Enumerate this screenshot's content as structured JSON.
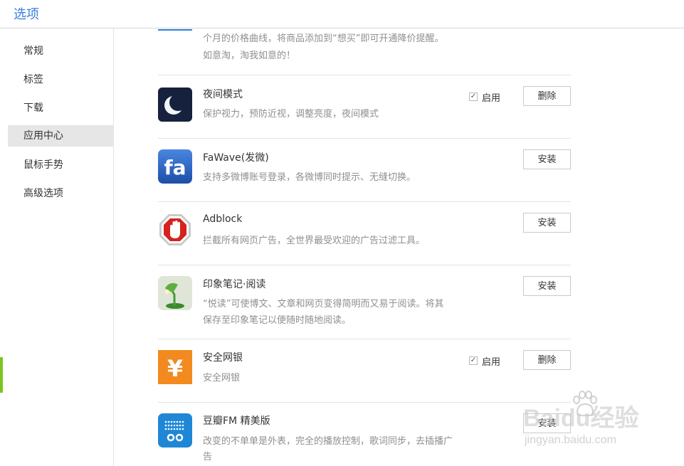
{
  "header": {
    "title": "选项"
  },
  "sidebar": {
    "items": [
      {
        "label": "常规"
      },
      {
        "label": "标签"
      },
      {
        "label": "下载"
      },
      {
        "label": "应用中心",
        "active": true
      },
      {
        "label": "鼠标手势"
      },
      {
        "label": "高级选项"
      }
    ]
  },
  "main": {
    "top_fragment": {
      "desc_line1": "个月的价格曲线，将商品添加到“想买”即可开通降价提醒。",
      "desc_line2": "如意淘，淘我如意的！"
    },
    "extensions": [
      {
        "name": "夜间模式",
        "desc_line1": "保护视力，预防近视，调整亮度，夜间模式",
        "enabled": true,
        "enable_label": "启用",
        "button": "删除",
        "icon": "moon-icon"
      },
      {
        "name": "FaWave(发微)",
        "desc_line1": "支持多微博账号登录，各微博同时提示、无缝切换。",
        "button": "安装",
        "icon": "fawave-icon"
      },
      {
        "name": "Adblock",
        "desc_line1": "拦截所有网页广告，全世界最受欢迎的广告过滤工具。",
        "button": "安装",
        "icon": "adblock-hand-icon"
      },
      {
        "name": "印象笔记·阅读",
        "desc_line1": "“悦读”可使博文、文章和网页变得简明而又易于阅读。将其",
        "desc_line2": "保存至印象笔记以便随时随地阅读。",
        "button": "安装",
        "icon": "desk-lamp-icon"
      },
      {
        "name": "安全网银",
        "desc_line1": "安全网银",
        "enabled": true,
        "enable_label": "启用",
        "button": "删除",
        "icon": "yen-icon"
      },
      {
        "name": "豆瓣FM 精美版",
        "desc_line1": "改变的不单单是外表，完全的播放控制，歌词同步，去插播广",
        "desc_line2": "告",
        "button": "安装",
        "icon": "radio-icon"
      }
    ]
  },
  "watermark": {
    "main": "Baidu经验",
    "sub": "jingyan.baidu.com"
  },
  "colors": {
    "title_blue": "#3a7fd6",
    "active_nav_bg": "#e6e6e6",
    "left_marker_green": "#7cc520",
    "desc_gray": "#8f8f8f",
    "divider": "#e3e3e3"
  }
}
